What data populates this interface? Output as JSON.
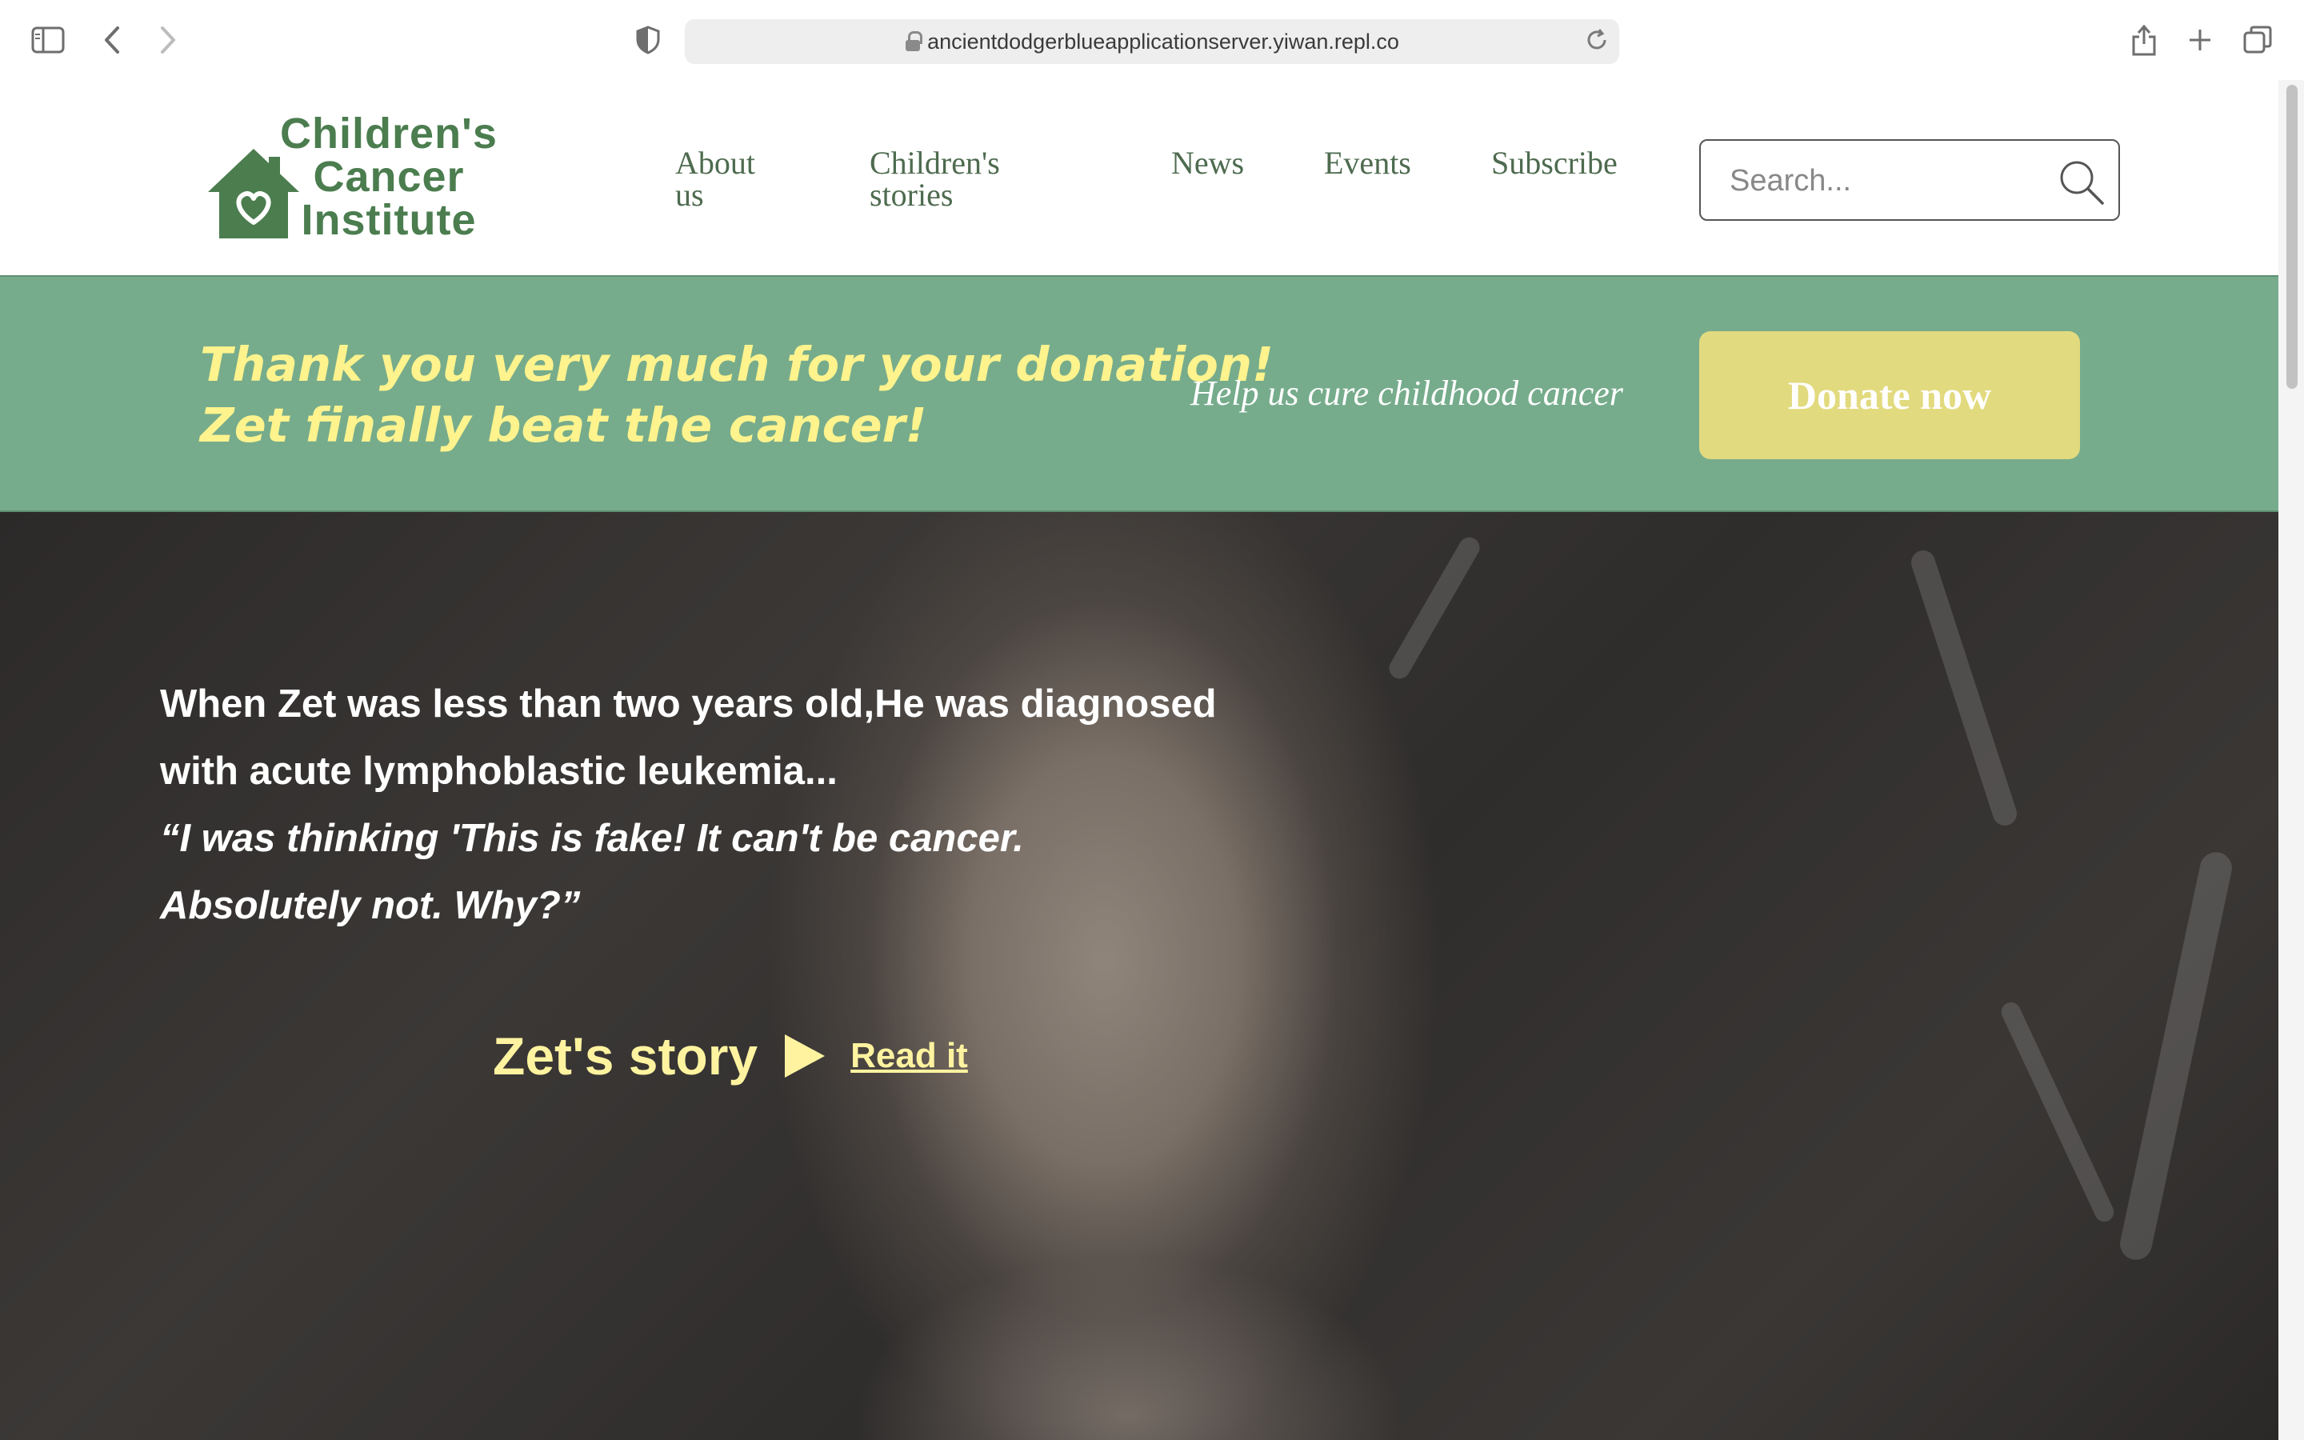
{
  "browser": {
    "url": "ancientdodgerblueapplicationserver.yiwan.repl.co"
  },
  "header": {
    "logo_lines": [
      "Children's",
      "Cancer",
      "Institute"
    ],
    "nav": [
      {
        "label_line1": "About",
        "label_line2": "us"
      },
      {
        "label_line1": "Children's",
        "label_line2": "stories"
      },
      {
        "label_line1": "News"
      },
      {
        "label_line1": "Events"
      },
      {
        "label_line1": "Subscribe"
      }
    ],
    "search": {
      "placeholder": "Search..."
    }
  },
  "banner": {
    "message_line1": "Thank you very much for your donation!",
    "message_line2": "Zet finally beat the cancer!",
    "help_text": "Help us cure childhood cancer",
    "donate_label": "Donate now"
  },
  "hero": {
    "intro_line1": "When Zet was less than two years old,He was diagnosed",
    "intro_line2": "with acute lymphoblastic leukemia...",
    "quote_line1": "“I was thinking 'This is fake! It can't be cancer.",
    "quote_line2": "Absolutely not. Why?”",
    "story_title": "Zet's story",
    "read_link": "Read it"
  },
  "colors": {
    "brand_green": "#4b7d4f",
    "banner_green": "#76ac8c",
    "banner_text_yellow": "#fff38d",
    "donate_button": "#e2da7e",
    "story_yellow": "#fff3a0"
  },
  "icons": [
    "sidebar-toggle-icon",
    "back-arrow-icon",
    "forward-arrow-icon",
    "privacy-shield-icon",
    "lock-icon",
    "reload-icon",
    "share-icon",
    "new-tab-plus-icon",
    "tabs-overview-icon",
    "house-heart-icon",
    "search-icon",
    "play-icon"
  ]
}
